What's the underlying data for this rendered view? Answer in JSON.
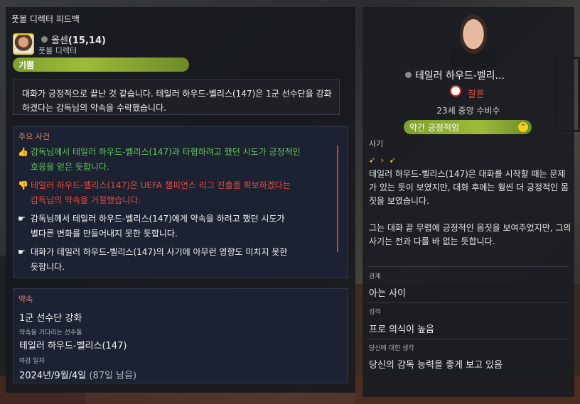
{
  "panel_title": "풋볼 디렉터 피드백",
  "director": {
    "name": "올센",
    "code": "(15,14)",
    "role": "풋볼 디렉터",
    "mood": "기쁨"
  },
  "quote": "대화가 긍정적으로 끝난 것 같습니다. 테일러 하우드-벨리스(147)은 1군 선수단을 강화하겠다는 감독님의 약속을 수락했습니다.",
  "events": {
    "title": "주요 사건",
    "items": [
      {
        "type": "positive",
        "icon": "thumbs-up-icon",
        "line1": "감독님께서 테일러 하우드-벨리스(147)과 타협하려고 했던 시도가 긍정적인",
        "line2": "호응을 얻은 듯합니다."
      },
      {
        "type": "negative",
        "icon": "thumbs-down-icon",
        "line1": "테일러 하우드-벨리스(147)은 UEFA 챔피언스 리그 진출을 확보하겠다는",
        "line2": "감독님의 약속을 거절했습니다."
      },
      {
        "type": "neutral",
        "icon": "hand-point-icon",
        "line1": "감독님께서 테일러 하우드-벨리스(147)에게 약속을 하려고 했던 시도가",
        "line2": "별다른 변화를 만들어내지 못한 듯합니다."
      },
      {
        "type": "neutral",
        "icon": "hand-point-icon",
        "line1": "대화가 테일러 하우드-벨리스(147)의 사기에 아무런 영향도 미치지 못한",
        "line2": "듯합니다."
      }
    ]
  },
  "promise": {
    "title": "약속",
    "value": "1군 선수단 강화",
    "waiting_label": "약속을 기다리는 선수들",
    "waiting_value": "테일러 하우드-벨리스(147)",
    "deadline_label": "마감 일자",
    "deadline_value": "2024년/9월/4일",
    "deadline_remaining": "(87일 남음)"
  },
  "player": {
    "name": "테일러 하우드-벨리...",
    "club": "찰튼",
    "info": "23세 중앙 수비수",
    "mood": "약간 긍정적임",
    "morale_title": "사기",
    "morale_icons": "➹ › ➹",
    "morale_text1": "테일러 하우드-벨리스(147)은 대화를 시작할 때는 문제가 있는 듯이 보였지만, 대화 후에는 훨씬 더 긍정적인 몸짓을 보였습니다.",
    "morale_text2": "그는 대화 끝 무렵에 긍정적인 몸짓을 보여주었지만, 그의 사기는 전과 다를 바 없는 듯합니다.",
    "relation_label": "관계",
    "relation_value": "아는 사이",
    "personality_label": "성격",
    "personality_value": "프로 의식이 높음",
    "opinion_label": "당신에 대한 생각",
    "opinion_value": "당신의 감독 능력을 좋게 보고 있음"
  },
  "colors": {
    "mood_green": "#8fae33",
    "positive": "#5ecb57",
    "negative": "#e64a3c",
    "accent": "#e98a60"
  }
}
